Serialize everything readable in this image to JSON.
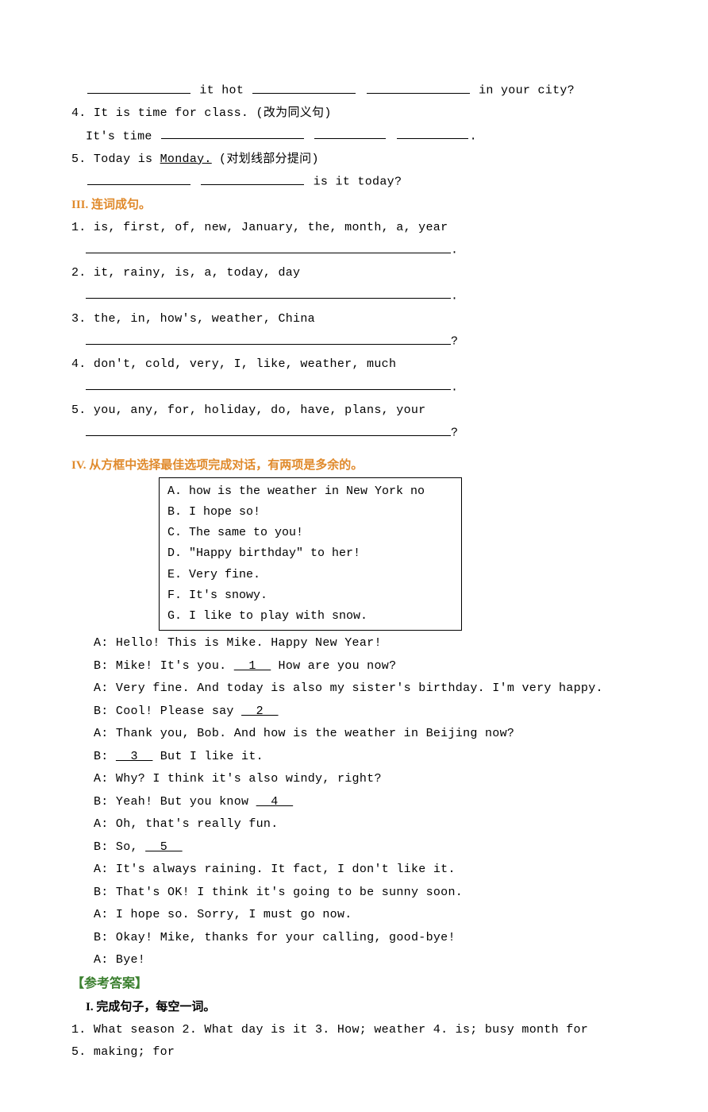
{
  "pre": {
    "q3_part1": "it hot",
    "q3_part2": "in your city?",
    "q4_prompt": "4. It is time for class. (改为同义句)",
    "q4_stub": "It's time",
    "q5_prompt_a": "5. Today is ",
    "q5_under": "Monday.",
    "q5_prompt_b": " (对划线部分提问)",
    "q5_tail": "is it today?"
  },
  "secIII": {
    "title": "III. 连词成句。",
    "items": [
      "1. is, first, of, new, January, the, month, a, year",
      "2. it, rainy, is, a, today, day",
      "3. the, in, how's, weather, China",
      "4. don't, cold, very, I, like, weather, much",
      "5. you, any, for, holiday, do, have, plans, your"
    ],
    "punct": [
      ".",
      ".",
      "?",
      ".",
      "?"
    ]
  },
  "secIV": {
    "title": "IV. 从方框中选择最佳选项完成对话，有两项是多余的。",
    "box": [
      "A. how is the weather in New York no",
      "B. I hope so!",
      "C. The same to you!",
      "D. \"Happy birthday\" to her!",
      "E. Very fine.",
      "F. It's snowy.",
      "G. I like to play with snow."
    ],
    "dialog": [
      "A: Hello!  This is Mike. Happy New Year!",
      "B: Mike! It's you. __1__ How are you now?",
      "A: Very fine. And today is also my sister's birthday. I'm very happy.",
      "B: Cool! Please say __2__",
      "A: Thank you, Bob. And how is the weather in Beijing now?",
      "B: __3__ But I like it.",
      "A: Why? I think it's also windy, right?",
      "B: Yeah! But you know __4__",
      "A: Oh, that's really fun.",
      "B: So, __5__",
      "A: It's always raining. It fact, I don't like it.",
      "B: That's OK! I think it's going to be sunny soon.",
      "A: I hope so. Sorry, I must go now.",
      "B: Okay! Mike, thanks for your calling, good-bye!",
      "A: Bye!"
    ]
  },
  "answers": {
    "head": "【参考答案】",
    "sub": "I. 完成句子，每空一词。",
    "line1": "1. What season  2. What day is it  3. How; weather  4. is; busy month for",
    "line2": "5. making; for"
  }
}
